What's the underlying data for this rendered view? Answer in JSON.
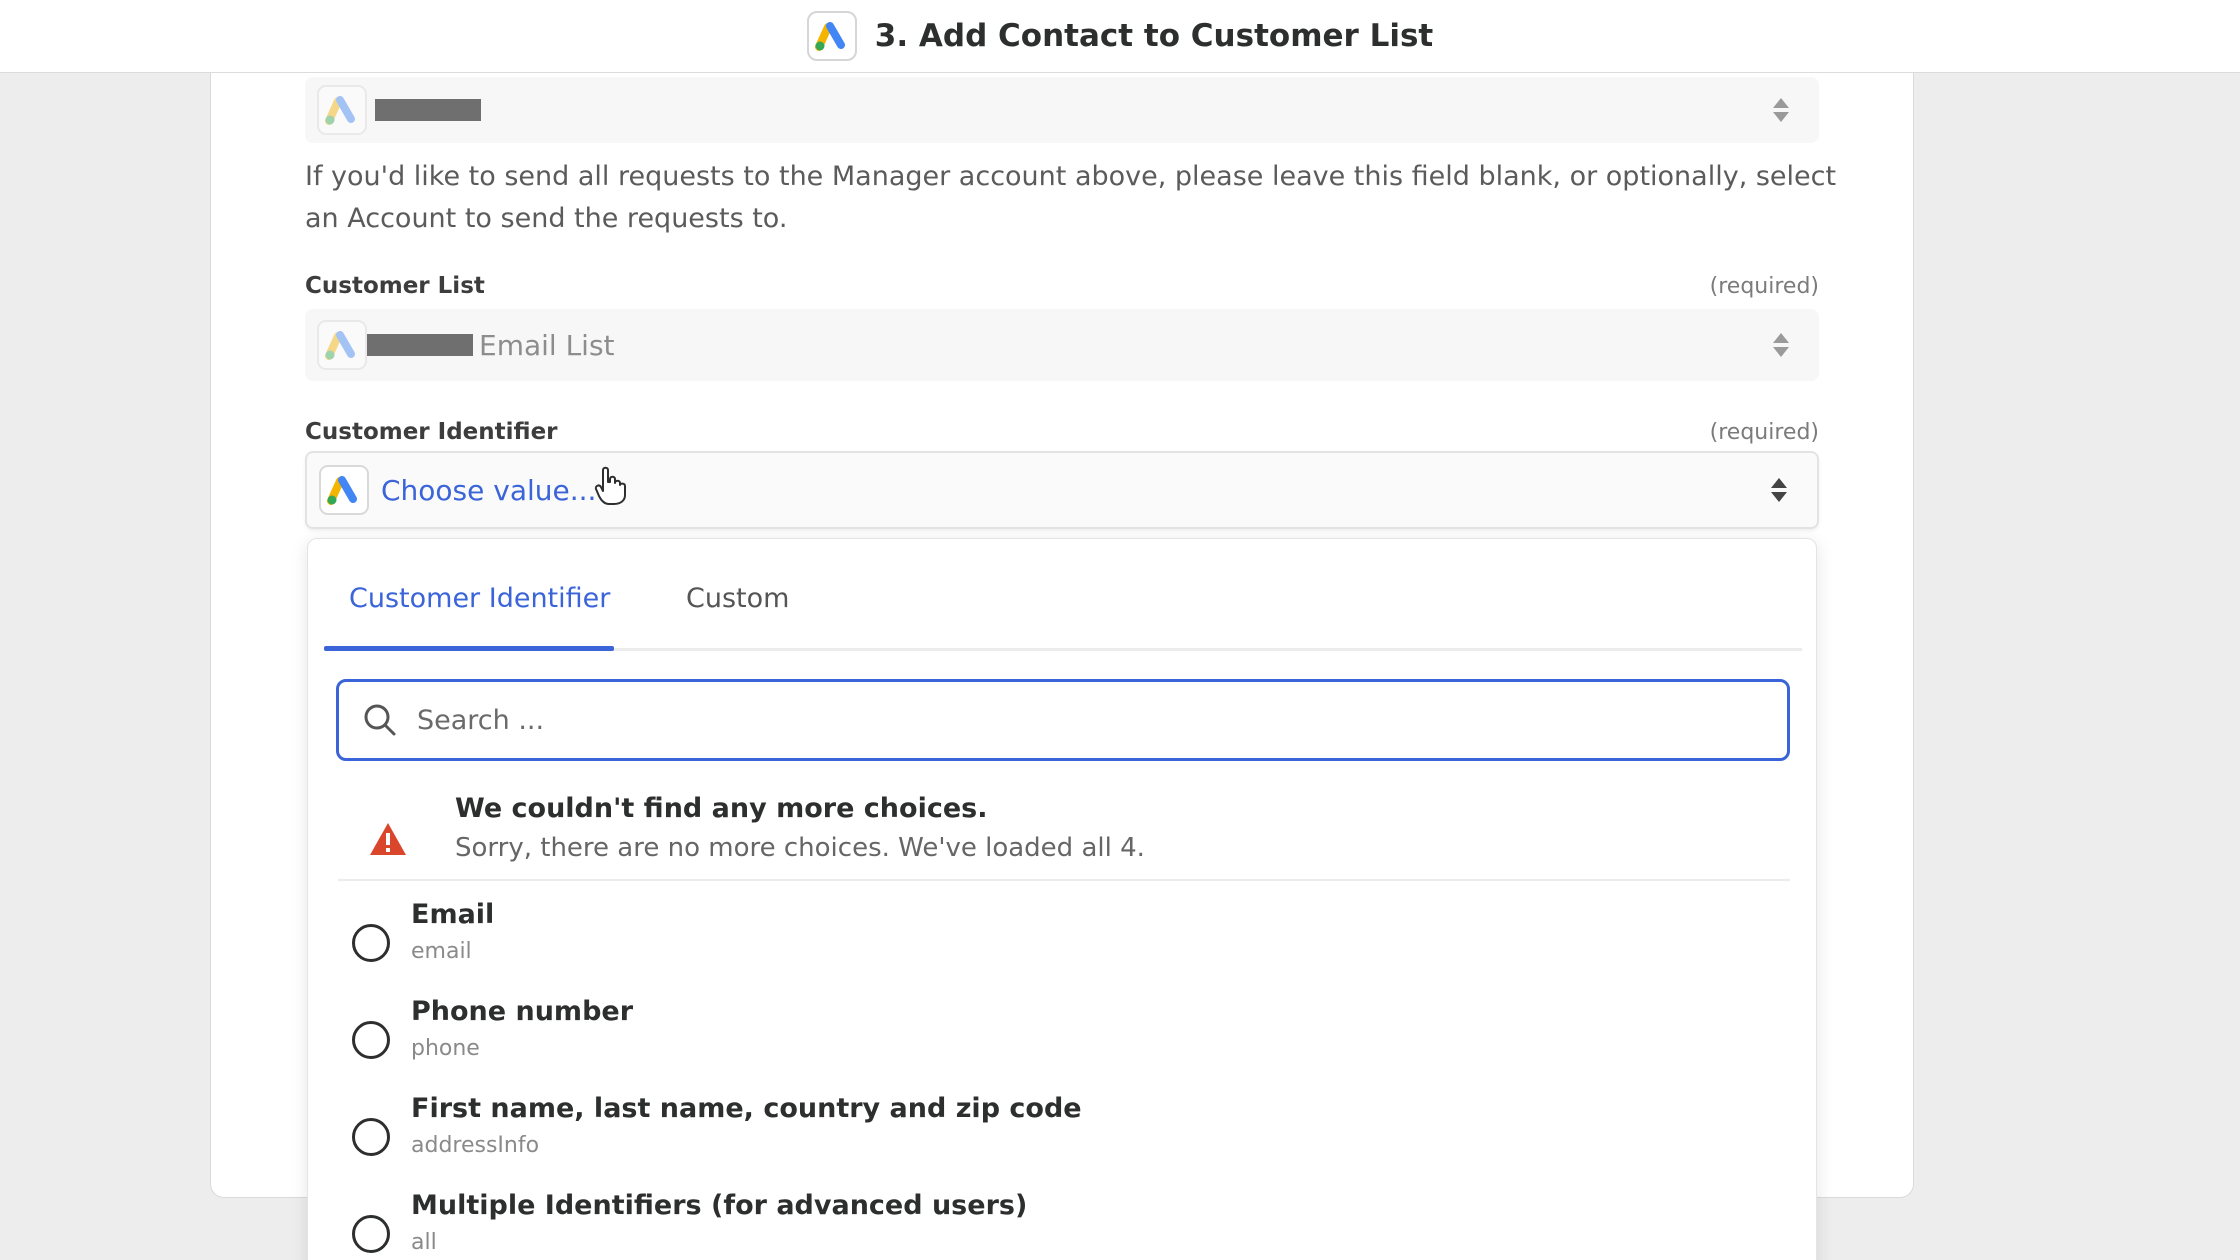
{
  "header": {
    "title": "3. Add Contact to Customer List",
    "app_icon": "google-ads-icon"
  },
  "account_field": {
    "help_text": "If you'd like to send all requests to the Manager account above, please leave this field blank, or optionally, select an Account to send the requests to."
  },
  "customer_list_field": {
    "label": "Customer List",
    "required": "(required)",
    "value": "Email List"
  },
  "customer_identifier_field": {
    "label": "Customer Identifier",
    "required": "(required)",
    "placeholder": "Choose value..."
  },
  "dropdown": {
    "tabs": [
      {
        "label": "Customer Identifier",
        "active": true
      },
      {
        "label": "Custom",
        "active": false
      }
    ],
    "search_placeholder": "Search ...",
    "notice": {
      "title": "We couldn't find any more choices.",
      "body": "Sorry, there are no more choices. We've loaded all 4."
    },
    "options": [
      {
        "label": "Email",
        "key": "email"
      },
      {
        "label": "Phone number",
        "key": "phone"
      },
      {
        "label": "First name, last name, country and zip code",
        "key": "addressInfo"
      },
      {
        "label": "Multiple Identifiers (for advanced users)",
        "key": "all"
      }
    ]
  },
  "colors": {
    "accent": "#3a64d8",
    "warning": "#d9462b"
  }
}
